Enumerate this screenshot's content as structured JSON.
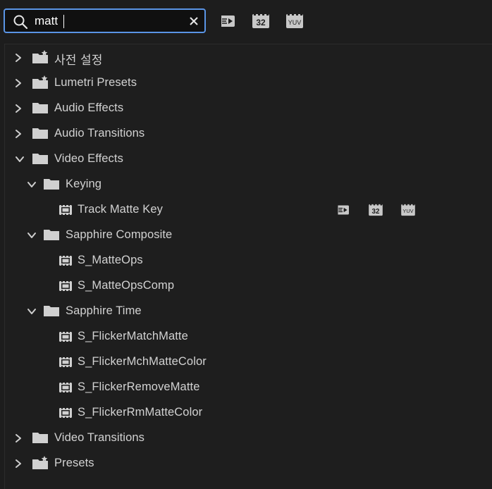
{
  "search": {
    "value": "matt"
  },
  "toolbar": {
    "badges": [
      "accelerated-effects-icon",
      "32-bit-color-icon",
      "yuv-icon"
    ],
    "badge_32": "32",
    "badge_yuv": "YUV"
  },
  "tree": {
    "presets_ko": "사전 설정",
    "lumetri_presets": "Lumetri Presets",
    "audio_effects": "Audio Effects",
    "audio_transitions": "Audio Transitions",
    "video_effects": "Video Effects",
    "keying": "Keying",
    "track_matte_key": "Track Matte Key",
    "sapphire_composite": "Sapphire Composite",
    "s_matteops": "S_MatteOps",
    "s_matteopscomp": "S_MatteOpsComp",
    "sapphire_time": "Sapphire Time",
    "s_flickermatchmatte": "S_FlickerMatchMatte",
    "s_flickermchmattecolor": "S_FlickerMchMatteColor",
    "s_flickerremovematte": "S_FlickerRemoveMatte",
    "s_flickerrmmattecolor": "S_FlickerRmMatteColor",
    "video_transitions": "Video Transitions",
    "presets": "Presets"
  },
  "colors": {
    "accent": "#5a95e6",
    "background": "#1d1d1d",
    "text": "#d2d2d2"
  }
}
